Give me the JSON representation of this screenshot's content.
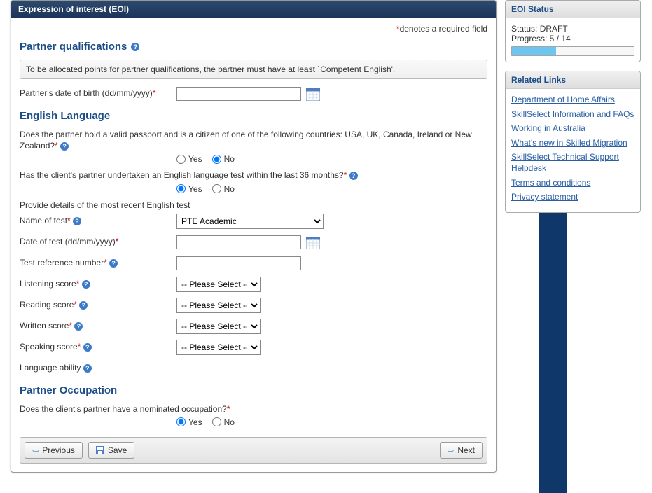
{
  "header": {
    "title": "Expression of interest (EOI)"
  },
  "requiredNote": {
    "ast": "*",
    "text": "denotes a required field"
  },
  "sections": {
    "partnerQual": "Partner qualifications",
    "english": "English Language",
    "occupation": "Partner Occupation"
  },
  "hint": "To be allocated points for partner qualifications, the partner must have at least `Competent English'.",
  "fields": {
    "partnerDob": "Partner's date of birth (dd/mm/yyyy)",
    "passportQ": "Does the partner hold a valid passport and is a citizen of one of the following countries: USA, UK, Canada, Ireland or New Zealand?",
    "englishTestQ": "Has the client's partner undertaken an English language test within the last 36 months?",
    "recentTestIntro": "Provide details of the most recent English test",
    "nameOfTest": "Name of test",
    "dateOfTest": "Date of test (dd/mm/yyyy)",
    "testRef": "Test reference number",
    "listening": "Listening score",
    "reading": "Reading score",
    "written": "Written score",
    "speaking": "Speaking score",
    "languageAbility": "Language ability",
    "nominatedQ": "Does the client's partner have a nominated occupation?"
  },
  "options": {
    "yes": "Yes",
    "no": "No",
    "testName": "PTE Academic",
    "pleaseSelect": "-- Please Select --"
  },
  "buttons": {
    "previous": "Previous",
    "save": "Save",
    "next": "Next"
  },
  "sidebar": {
    "statusHeader": "EOI Status",
    "statusLabel": "Status: DRAFT",
    "progressLabel": "Progress: 5 / 14",
    "progressPercent": 36,
    "linksHeader": "Related Links",
    "links": [
      "Department of Home Affairs",
      "SkillSelect Information and FAQs",
      "Working in Australia",
      "What's new in Skilled Migration",
      "SkillSelect Technical Support Helpdesk",
      "Terms and conditions",
      "Privacy statement"
    ]
  }
}
